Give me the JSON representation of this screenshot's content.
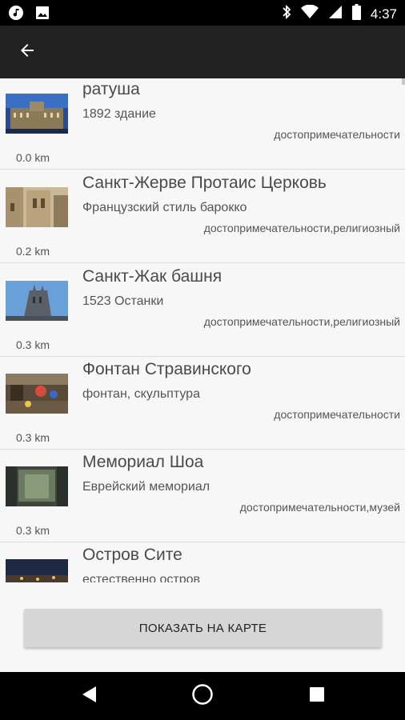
{
  "status_bar": {
    "time": "4:37",
    "left_icons": [
      "music-note-icon",
      "image-icon"
    ],
    "right_icons": [
      "bluetooth-icon",
      "wifi-icon",
      "signal-icon",
      "battery-icon"
    ]
  },
  "app_bar": {
    "back_icon": "arrow-left-icon",
    "background": "#212121"
  },
  "places": [
    {
      "name": "ратуша",
      "description": "1892 здание",
      "categories": "достопримечательности",
      "distance": "0.0 km",
      "image": "building-icon"
    },
    {
      "name": "Санкт-Жерве Протаис Церковь",
      "description": "Французский стиль барокко",
      "categories": "достопримечательности,религиозный",
      "distance": "0.2 km",
      "image": "church-icon"
    },
    {
      "name": "Санкт-Жак башня",
      "description": "1523 Останки",
      "categories": "достопримечательности,религиозный",
      "distance": "0.3 km",
      "image": "tower-icon"
    },
    {
      "name": "Фонтан Стравинского",
      "description": "фонтан, скульптура",
      "categories": "достопримечательности",
      "distance": "0.3 km",
      "image": "fountain-icon"
    },
    {
      "name": "Мемориал Шоа",
      "description": "Еврейский мемориал",
      "categories": "достопримечательности,музей",
      "distance": "0.3 km",
      "image": "memorial-icon"
    },
    {
      "name": "Остров Сите",
      "description": "естественно остров",
      "categories": "",
      "distance": "",
      "image": "island-icon"
    }
  ],
  "show_map_button": {
    "label": "ПОКАЗАТЬ НА КАРТЕ"
  },
  "nav_bar": {
    "icons": [
      "back-triangle-icon",
      "home-circle-icon",
      "recents-square-icon"
    ]
  }
}
